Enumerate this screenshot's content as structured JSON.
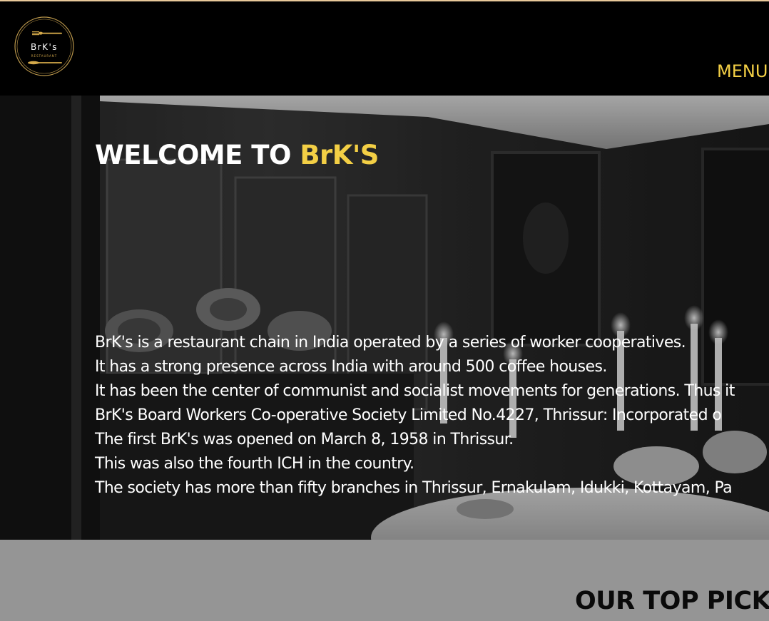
{
  "brand": {
    "logo_text": "BrK's",
    "logo_subtext": "RESTAURANT",
    "accent_color": "#f3cf45"
  },
  "nav": {
    "menu_label": "MENU"
  },
  "hero": {
    "title_prefix": "WELCOME TO ",
    "title_brand": "BrK'S",
    "paragraphs": [
      "BrK's is a restaurant chain in India operated by a series of worker cooperatives.",
      "It has a strong presence across India with around 500 coffee houses.",
      "It has been the center of communist and socialist movements for generations. Thus it",
      "BrK's Board Workers Co-operative Society Limited No.4227, Thrissur: Incorporated o",
      "The first BrK's was opened on March 8, 1958 in Thrissur.",
      "This was also the fourth ICH in the country.",
      "The society has more than fifty branches in Thrissur, Ernakulam, Idukki, Kottayam, Pa"
    ]
  },
  "section": {
    "top_picks_title": "OUR TOP PICKS"
  }
}
